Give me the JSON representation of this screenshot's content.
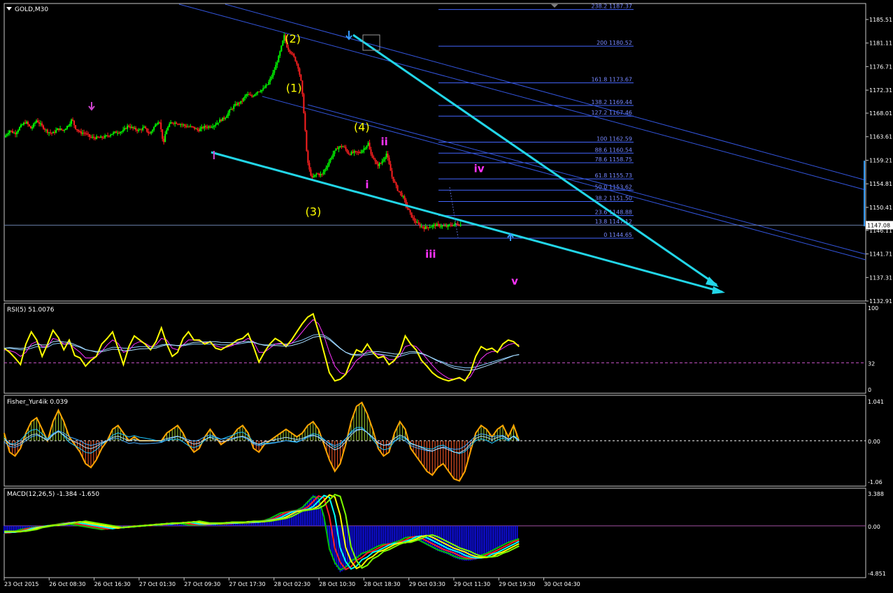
{
  "chart_data": [
    {
      "type": "candlestick",
      "title": "GOLD,M30",
      "symbol": "GOLD",
      "timeframe": "M30",
      "ylim": [
        1132.91,
        1188.5
      ],
      "y_ticks": [
        "1185.51",
        "1181.11",
        "1176.71",
        "1172.31",
        "1168.01",
        "1163.61",
        "1159.21",
        "1154.81",
        "1150.41",
        "1146.11",
        "1141.71",
        "1137.31",
        "1132.91"
      ],
      "current_price": "1147.08",
      "x_ticks": [
        "23 Oct 2015",
        "26 Oct 08:30",
        "26 Oct 16:30",
        "27 Oct 01:30",
        "27 Oct 09:30",
        "27 Oct 17:30",
        "28 Oct 02:30",
        "28 Oct 10:30",
        "28 Oct 18:30",
        "29 Oct 03:30",
        "29 Oct 11:30",
        "29 Oct 19:30",
        "30 Oct 04:30"
      ],
      "close_path": [
        [
          0,
          1163.5
        ],
        [
          0.5,
          1164.8
        ],
        [
          1,
          1164.2
        ],
        [
          1.5,
          1165.5
        ],
        [
          2,
          1166.4
        ],
        [
          2.5,
          1165.1
        ],
        [
          3,
          1166.7
        ],
        [
          3.5,
          1165.6
        ],
        [
          4,
          1164.6
        ],
        [
          4.5,
          1164.2
        ],
        [
          5,
          1165.1
        ],
        [
          5.5,
          1164.8
        ],
        [
          6,
          1165.9
        ],
        [
          6.3,
          1166.9
        ],
        [
          6.6,
          1165.3
        ],
        [
          7,
          1164.4
        ],
        [
          7.5,
          1164.3
        ],
        [
          8,
          1163.5
        ],
        [
          8.5,
          1163.4
        ],
        [
          9,
          1163.4
        ],
        [
          9.5,
          1163.7
        ],
        [
          10,
          1164.2
        ],
        [
          10.5,
          1164.5
        ],
        [
          11,
          1164.6
        ],
        [
          11.5,
          1165.7
        ],
        [
          12,
          1165.1
        ],
        [
          12.5,
          1164.8
        ],
        [
          13,
          1165.3
        ],
        [
          13.5,
          1164.1
        ],
        [
          14,
          1165.7
        ],
        [
          14.4,
          1166.8
        ],
        [
          14.8,
          1162.1
        ],
        [
          15,
          1164.7
        ],
        [
          15.5,
          1166.3
        ],
        [
          16,
          1166.2
        ],
        [
          16.5,
          1165.9
        ],
        [
          17,
          1165.5
        ],
        [
          17.5,
          1165.4
        ],
        [
          18,
          1164.8
        ],
        [
          18.5,
          1165.4
        ],
        [
          19,
          1165.5
        ],
        [
          19.5,
          1165.8
        ],
        [
          20,
          1166.6
        ],
        [
          20.5,
          1167.2
        ],
        [
          21,
          1168.6
        ],
        [
          21.5,
          1169.6
        ],
        [
          22,
          1170.1
        ],
        [
          22.5,
          1171.5
        ],
        [
          23,
          1171.1
        ],
        [
          23.5,
          1172.1
        ],
        [
          24,
          1172.4
        ],
        [
          24.5,
          1173.5
        ],
        [
          25,
          1175.6
        ],
        [
          25.5,
          1178.6
        ],
        [
          26,
          1182.4
        ],
        [
          26.3,
          1180.2
        ],
        [
          26.6,
          1179.5
        ],
        [
          27,
          1178.1
        ],
        [
          27.3,
          1176.6
        ],
        [
          27.6,
          1173.5
        ],
        [
          27.9,
          1166.3
        ],
        [
          28.1,
          1160.1
        ],
        [
          28.3,
          1157.6
        ],
        [
          28.6,
          1155.8
        ],
        [
          29,
          1156.7
        ],
        [
          29.5,
          1156.5
        ],
        [
          30,
          1158.3
        ],
        [
          30.5,
          1160.3
        ],
        [
          31,
          1161.7
        ],
        [
          31.5,
          1161.8
        ],
        [
          32,
          1160.4
        ],
        [
          32.5,
          1160.7
        ],
        [
          33,
          1160.6
        ],
        [
          33.5,
          1161.6
        ],
        [
          33.8,
          1162.4
        ],
        [
          34,
          1160.5
        ],
        [
          34.3,
          1159.6
        ],
        [
          34.6,
          1158.2
        ],
        [
          35,
          1158.7
        ],
        [
          35.5,
          1160.5
        ],
        [
          36,
          1156.2
        ],
        [
          36.5,
          1153.8
        ],
        [
          37,
          1152.5
        ],
        [
          37.5,
          1150.0
        ],
        [
          38,
          1148.1
        ],
        [
          38.5,
          1147.1
        ],
        [
          39,
          1146.6
        ],
        [
          39.5,
          1146.8
        ],
        [
          40,
          1147.1
        ],
        [
          40.5,
          1147.0
        ],
        [
          41,
          1146.8
        ],
        [
          41.5,
          1147.1
        ],
        [
          42,
          1147.3
        ],
        [
          42.5,
          1147.1
        ]
      ],
      "fibonacci": [
        {
          "label": "238.2 1187.37",
          "price": 1187.37
        },
        {
          "label": "200 1180.52",
          "price": 1180.52
        },
        {
          "label": "161.8 1173.67",
          "price": 1173.67
        },
        {
          "label": "138.2 1169.44",
          "price": 1169.44
        },
        {
          "label": "127.2 1167.46",
          "price": 1167.46
        },
        {
          "label": "100 1162.59",
          "price": 1162.59
        },
        {
          "label": "88.6 1160.54",
          "price": 1160.54
        },
        {
          "label": "78.6 1158.75",
          "price": 1158.75
        },
        {
          "label": "61.8 1155.73",
          "price": 1155.73
        },
        {
          "label": "50.0 1153.62",
          "price": 1153.62
        },
        {
          "label": "38.2 1151.50",
          "price": 1151.5
        },
        {
          "label": "23.6 1148.88",
          "price": 1148.88
        },
        {
          "label": "13.8 1147.12",
          "price": 1147.12
        },
        {
          "label": "0 1144.65",
          "price": 1144.65
        }
      ],
      "wave_labels": [
        {
          "text": "(2)",
          "color": "#ffff00",
          "t": 26.8,
          "price": 1181.2
        },
        {
          "text": "(1)",
          "color": "#ffff00",
          "t": 26.9,
          "price": 1172.0
        },
        {
          "text": "(3)",
          "color": "#ffff00",
          "t": 28.7,
          "price": 1148.9
        },
        {
          "text": "(4)",
          "color": "#ffff00",
          "t": 33.2,
          "price": 1164.7
        },
        {
          "text": "ii",
          "color": "#ff33ff",
          "t": 35.3,
          "price": 1162.0
        },
        {
          "text": "i",
          "color": "#ff33ff",
          "t": 33.7,
          "price": 1154.0
        },
        {
          "text": "iv",
          "color": "#ff33ff",
          "t": 44.1,
          "price": 1157.0
        },
        {
          "text": "iii",
          "color": "#ff33ff",
          "t": 39.6,
          "price": 1141.0
        },
        {
          "text": "v",
          "color": "#ff33ff",
          "t": 47.4,
          "price": 1136.0
        }
      ]
    },
    {
      "type": "line",
      "title": "RSI(5) 51.0076",
      "ylim": [
        0,
        100
      ],
      "y_ticks": [
        "100",
        "32",
        "0"
      ],
      "level": 32,
      "series": [
        {
          "color": "#ffff00",
          "values": [
            50,
            45,
            38,
            30,
            55,
            70,
            60,
            40,
            55,
            72,
            63,
            48,
            60,
            41,
            38,
            28,
            35,
            40,
            55,
            62,
            70,
            50,
            30,
            52,
            65,
            60,
            55,
            48,
            58,
            75,
            55,
            40,
            45,
            62,
            70,
            60,
            60,
            55,
            58,
            50,
            48,
            52,
            55,
            60,
            62,
            68,
            52,
            33,
            45,
            55,
            62,
            58,
            52,
            60,
            70,
            80,
            88,
            92,
            70,
            45,
            20,
            10,
            12,
            18,
            35,
            48,
            45,
            55,
            45,
            38,
            40,
            30,
            35,
            45,
            65,
            55,
            48,
            35,
            28,
            20,
            15,
            12,
            10,
            12,
            14,
            10,
            20,
            40,
            52,
            48,
            50,
            45,
            55,
            60,
            58,
            52
          ]
        },
        {
          "color": "#ff33ff",
          "values": [
            48,
            47,
            45,
            40,
            45,
            55,
            58,
            52,
            52,
            62,
            60,
            55,
            56,
            50,
            45,
            38,
            38,
            40,
            46,
            54,
            60,
            56,
            45,
            47,
            55,
            58,
            56,
            52,
            54,
            62,
            60,
            50,
            48,
            54,
            60,
            60,
            59,
            57,
            57,
            53,
            51,
            51,
            53,
            56,
            58,
            62,
            58,
            45,
            45,
            50,
            55,
            56,
            54,
            56,
            62,
            70,
            78,
            85,
            80,
            65,
            45,
            28,
            20,
            18,
            25,
            35,
            40,
            47,
            46,
            42,
            41,
            36,
            36,
            40,
            52,
            54,
            52,
            45,
            37,
            29,
            22,
            17,
            13,
            12,
            13,
            11,
            15,
            26,
            37,
            43,
            46,
            46,
            50,
            54,
            56,
            54
          ]
        },
        {
          "color": "#88ccff",
          "values": [
            50,
            50,
            49,
            48,
            48,
            50,
            52,
            51,
            51,
            55,
            56,
            55,
            55,
            53,
            51,
            48,
            47,
            46,
            47,
            49,
            51,
            51,
            50,
            50,
            51,
            52,
            52,
            52,
            52,
            54,
            55,
            54,
            53,
            53,
            54,
            55,
            55,
            55,
            55,
            55,
            54,
            54,
            54,
            55,
            56,
            57,
            57,
            55,
            54,
            54,
            55,
            55,
            55,
            56,
            58,
            60,
            63,
            66,
            67,
            66,
            62,
            56,
            50,
            45,
            42,
            41,
            41,
            42,
            43,
            43,
            42,
            41,
            40,
            40,
            42,
            44,
            44,
            43,
            41,
            38,
            35,
            33,
            30,
            28,
            27,
            26,
            26,
            27,
            29,
            31,
            33,
            35,
            37,
            39,
            41,
            42
          ]
        }
      ]
    },
    {
      "type": "histogram",
      "title": "Fisher_Yur4ik 0.039",
      "ylim": [
        -1.06,
        1.041
      ],
      "y_ticks": [
        "1.041",
        "0.00",
        "-1.06"
      ],
      "series": [
        {
          "color": "#ffff00",
          "values": [
            0.2,
            -0.3,
            -0.4,
            -0.2,
            0.2,
            0.5,
            0.6,
            0.3,
            0.0,
            0.5,
            0.8,
            0.5,
            0.1,
            -0.1,
            -0.3,
            -0.6,
            -0.7,
            -0.5,
            -0.2,
            0.0,
            0.3,
            0.4,
            0.2,
            0.0,
            0.1,
            0.0,
            0.0,
            0.0,
            0.0,
            0.0,
            0.2,
            0.3,
            0.4,
            0.2,
            -0.1,
            -0.3,
            -0.2,
            0.1,
            0.3,
            0.1,
            -0.1,
            0.0,
            0.1,
            0.3,
            0.4,
            0.2,
            -0.2,
            -0.3,
            -0.1,
            0.0,
            0.1,
            0.2,
            0.3,
            0.2,
            0.1,
            0.2,
            0.4,
            0.5,
            0.3,
            -0.1,
            -0.5,
            -0.8,
            -0.6,
            -0.1,
            0.5,
            0.9,
            1.0,
            0.7,
            0.3,
            -0.2,
            -0.4,
            -0.3,
            0.2,
            0.5,
            0.3,
            -0.2,
            -0.4,
            -0.6,
            -0.8,
            -0.9,
            -0.7,
            -0.6,
            -0.8,
            -1.0,
            -1.05,
            -0.8,
            -0.3,
            0.2,
            0.4,
            0.3,
            0.1,
            0.3,
            0.4,
            0.1,
            0.4,
            0.0
          ]
        }
      ]
    },
    {
      "type": "histogram",
      "title": "MACD(12,26,5) -1.384 -1.650",
      "ylim": [
        -4.851,
        3.388
      ],
      "y_ticks": [
        "3.388",
        "0.00",
        "-4.851"
      ],
      "series": [
        {
          "color": "#0000ff",
          "values": [
            -0.8,
            -0.7,
            -0.6,
            -0.4,
            -0.3,
            -0.2,
            -0.1,
            -0.1,
            0.0,
            0.1,
            0.2,
            0.3,
            0.2,
            0.1,
            0.0,
            -0.1,
            -0.2,
            -0.3,
            -0.4,
            -0.3,
            -0.3,
            -0.2,
            -0.2,
            -0.1,
            -0.1,
            0.0,
            0.0,
            0.1,
            0.1,
            0.1,
            0.2,
            0.2,
            0.3,
            0.2,
            0.1,
            0.1,
            0.1,
            0.1,
            0.2,
            0.2,
            0.2,
            0.2,
            0.3,
            0.3,
            0.3,
            0.3,
            0.4,
            0.5,
            0.6,
            0.8,
            1.1,
            1.4,
            1.5,
            1.6,
            1.7,
            2.0,
            2.6,
            3.2,
            3.0,
            1.0,
            -2.5,
            -4.0,
            -4.8,
            -4.5,
            -3.8,
            -3.5,
            -3.0,
            -2.8,
            -2.5,
            -2.2,
            -2.0,
            -2.0,
            -1.8,
            -1.6,
            -1.3,
            -1.2,
            -1.4,
            -1.7,
            -2.0,
            -2.3,
            -2.6,
            -2.8,
            -3.0,
            -3.3,
            -3.5,
            -3.6,
            -3.6,
            -3.5,
            -3.2,
            -3.0,
            -2.7,
            -2.4,
            -2.1,
            -1.8,
            -1.6,
            -1.4
          ]
        }
      ]
    }
  ]
}
